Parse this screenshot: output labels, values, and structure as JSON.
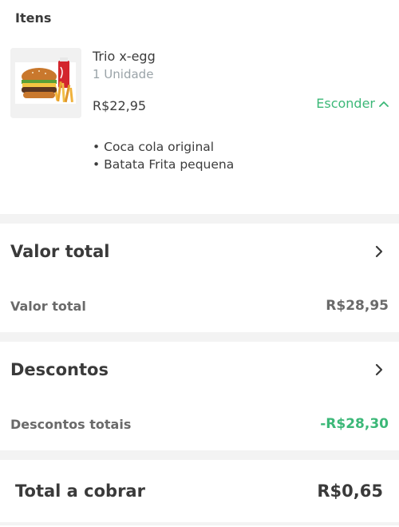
{
  "items_section": {
    "title": "Itens",
    "product": {
      "name": "Trio x-egg",
      "quantity": "1 Unidade",
      "price": "R$22,95",
      "hide_label": "Esconder",
      "addons": [
        "Coca cola original",
        "Batata Frita pequena"
      ]
    }
  },
  "valor_total": {
    "title": "Valor total",
    "row_label": "Valor total",
    "row_value": "R$28,95"
  },
  "descontos": {
    "title": "Descontos",
    "row_label": "Descontos totais",
    "row_value": "-R$28,30"
  },
  "total_cobrar": {
    "label": "Total a cobrar",
    "value": "R$0,65"
  },
  "colors": {
    "accent_green": "#3cb878",
    "separator": "#f3f3f3"
  },
  "icons": {
    "hide_chevron": "chevron-up-icon",
    "section_arrow": "chevron-right-icon"
  }
}
